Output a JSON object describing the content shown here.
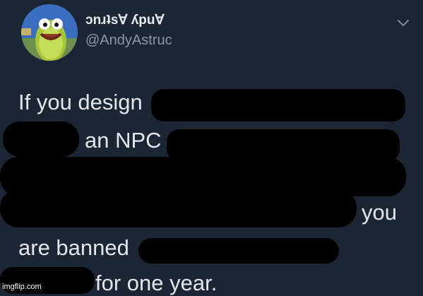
{
  "header": {
    "display_name": "ɔnɹʇs∀ ʎpu∀",
    "handle": "@AndyAstruc"
  },
  "icons": {
    "avatar": "green-fish-cartoon-avatar",
    "menu": "chevron-down-icon"
  },
  "tweet": {
    "line1": "If you design",
    "line2": "an NPC",
    "line3": "you",
    "line4": "are banned",
    "line5": "for one year."
  },
  "watermark": "imgflip.com",
  "colors": {
    "background": "#1c2533",
    "text": "#e3e6ea",
    "handle": "#8a97a6",
    "redaction": "#000000"
  }
}
